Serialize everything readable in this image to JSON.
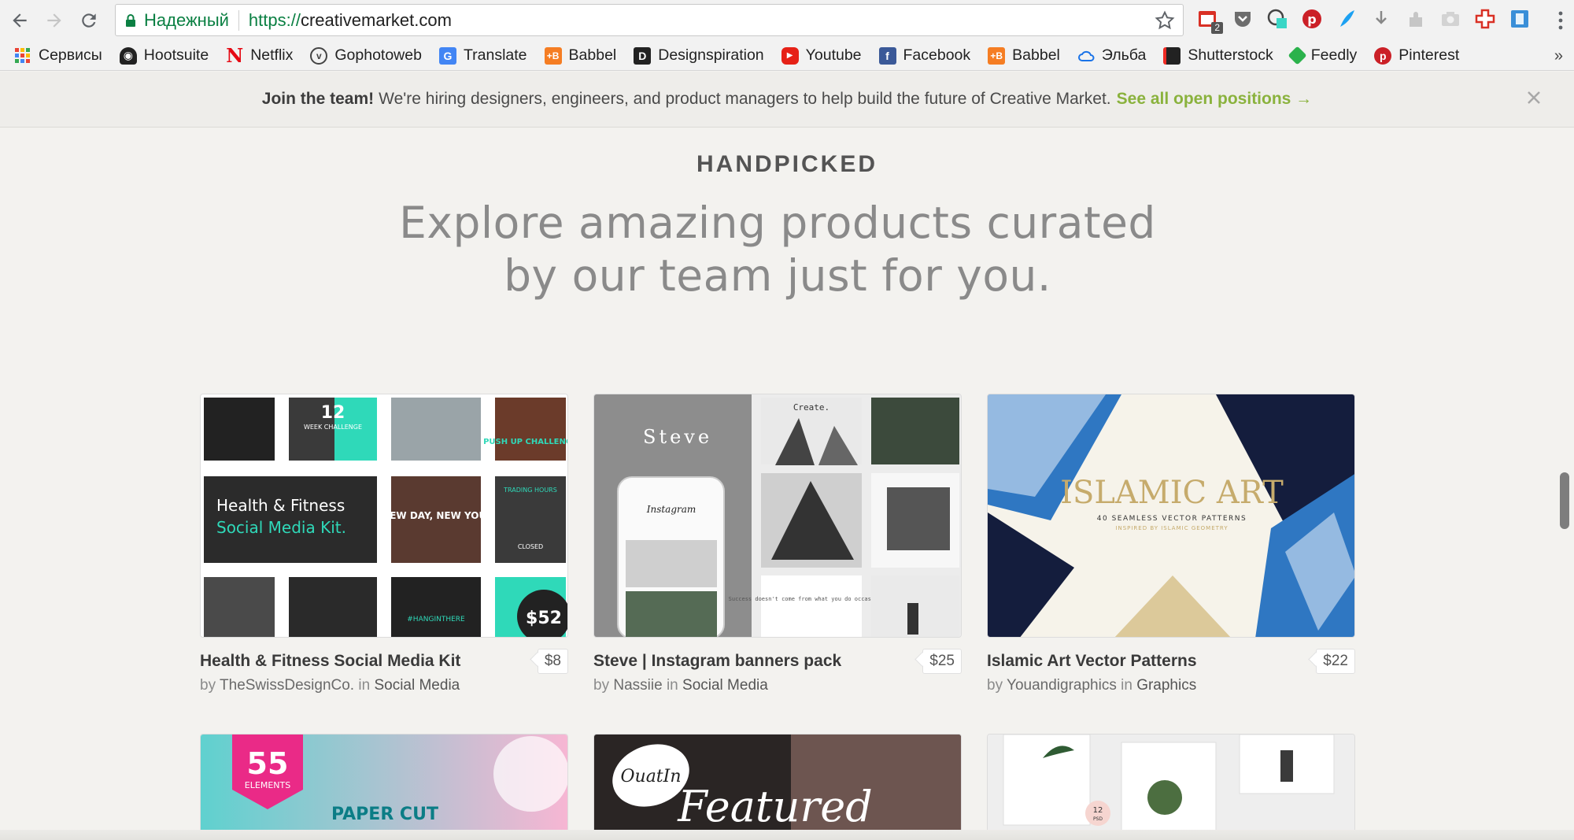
{
  "browser": {
    "secure_label": "Надежный",
    "url_scheme": "https://",
    "url_host": "creativemarket.com",
    "ext_badge": "2"
  },
  "bookmarks": [
    {
      "label": "Сервисы",
      "icon": "apps-grid-icon"
    },
    {
      "label": "Hootsuite",
      "icon": "hootsuite-owl-icon"
    },
    {
      "label": "Netflix",
      "icon": "netflix-icon"
    },
    {
      "label": "Gophotoweb",
      "icon": "gophotoweb-icon"
    },
    {
      "label": "Translate",
      "icon": "translate-icon"
    },
    {
      "label": "Babbel",
      "icon": "babbel-icon"
    },
    {
      "label": "Designspiration",
      "icon": "designspiration-icon"
    },
    {
      "label": "Youtube",
      "icon": "youtube-icon"
    },
    {
      "label": "Facebook",
      "icon": "facebook-icon"
    },
    {
      "label": "Babbel",
      "icon": "babbel-icon"
    },
    {
      "label": "Эльба",
      "icon": "elba-cloud-icon"
    },
    {
      "label": "Shutterstock",
      "icon": "shutterstock-icon"
    },
    {
      "label": "Feedly",
      "icon": "feedly-icon"
    },
    {
      "label": "Pinterest",
      "icon": "pinterest-icon"
    }
  ],
  "bookmarks_more": "»",
  "announcement": {
    "bold": "Join the team!",
    "text": "We're hiring designers, engineers, and product managers to help build the future of Creative Market.",
    "link": "See all open positions →"
  },
  "section": {
    "eyebrow": "HANDPICKED",
    "headline_line1": "Explore amazing products curated",
    "headline_line2": "by our team just for you."
  },
  "products": [
    {
      "title": "Health & Fitness Social Media Kit",
      "author": "TheSwissDesignCo.",
      "category": "Social Media",
      "price": "$8",
      "by": "by",
      "in": "in",
      "thumb_text": {
        "kit1": "Health & Fitness",
        "kit2": "Social Media Kit.",
        "num": "12",
        "week": "WEEK CHALLENGE",
        "pushup": "PUSH UP CHALLENGE",
        "newday": "NEW DAY, NEW YOU.",
        "hang": "#HANGINTHERE",
        "price": "$52",
        "hours": "TRADING HOURS",
        "closed": "CLOSED"
      }
    },
    {
      "title": "Steve | Instagram banners pack",
      "author": "Nassiie",
      "category": "Social Media",
      "price": "$25",
      "by": "by",
      "in": "in",
      "thumb_text": {
        "steve": "Steve",
        "create": "Create.",
        "insta": "Instagram",
        "quote": "Success doesn't come from what you do occasionally"
      }
    },
    {
      "title": "Islamic Art Vector Patterns",
      "author": "Youandigraphics",
      "category": "Graphics",
      "price": "$22",
      "by": "by",
      "in": "in",
      "thumb_text": {
        "title": "ISLAMIC ART",
        "sub": "40 SEAMLESS VECTOR PATTERNS",
        "sub2": "INSPIRED BY ISLAMIC GEOMETRY"
      }
    },
    {
      "thumb_text": {
        "num": "55",
        "elements": "ELEMENTS",
        "paper": "PAPER CUT"
      }
    },
    {
      "thumb_text": {
        "logo": "OuatIn",
        "featured": "Featured"
      }
    },
    {
      "thumb_text": {
        "n": "12",
        "psd": "PSD"
      }
    }
  ]
}
